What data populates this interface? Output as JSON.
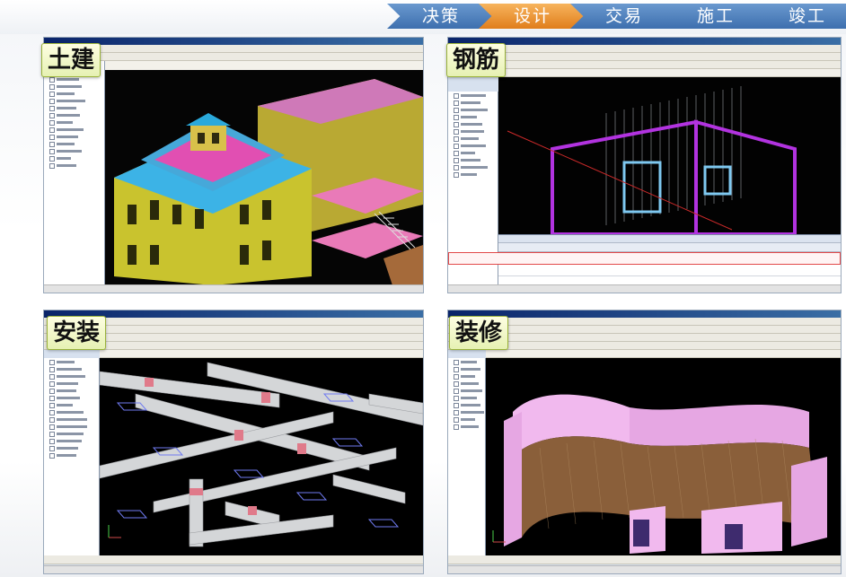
{
  "phases": [
    {
      "label": "决策",
      "active": false
    },
    {
      "label": "设计",
      "active": true
    },
    {
      "label": "交易",
      "active": false
    },
    {
      "label": "施工",
      "active": false
    },
    {
      "label": "竣工",
      "active": false
    }
  ],
  "panels": {
    "civil": {
      "label": "土建"
    },
    "rebar": {
      "label": "钢筋"
    },
    "install": {
      "label": "安装"
    },
    "decor": {
      "label": "装修"
    }
  },
  "colors": {
    "phase_normal": "#4a7fbf",
    "phase_active": "#ee9a37",
    "label_bg": "#eef5c4"
  }
}
